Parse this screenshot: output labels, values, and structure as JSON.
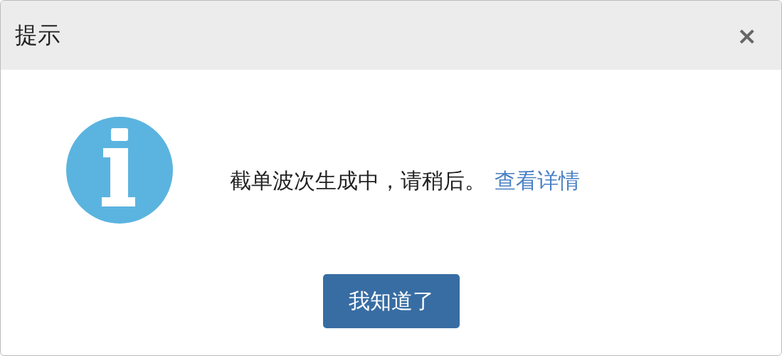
{
  "dialog": {
    "title": "提示",
    "close": "×",
    "message": "截单波次生成中，请稍后。",
    "link": "查看详情",
    "button": "我知道了"
  }
}
